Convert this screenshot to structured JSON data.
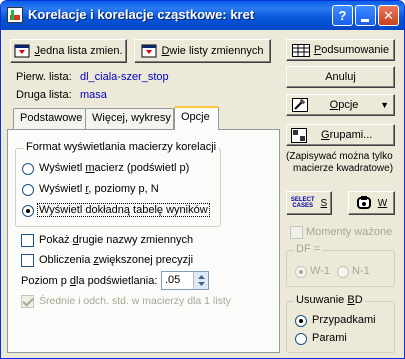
{
  "window": {
    "title": "Korelacje i korelacje cząstkowe: kret"
  },
  "buttons": {
    "jedna_lista": {
      "underline": "J",
      "rest": "edna lista zmien."
    },
    "dwie_listy": {
      "underline": "D",
      "rest": "wie listy zmiennych"
    },
    "podsumowanie": {
      "underline": "P",
      "rest": "odsumowanie"
    },
    "anuluj": "Anuluj",
    "opcje": {
      "underline": "O",
      "rest": "pcje"
    },
    "grupami": {
      "underline": "G",
      "rest": "rupami..."
    },
    "select_cases": {
      "line1": "SELECT",
      "line2": "CASES",
      "key": "S"
    },
    "weight": {
      "key": "W"
    }
  },
  "lists": {
    "first_label": "Pierw. lista:",
    "first_value": "dl_ciala-szer_stop",
    "second_label": "Druga lista:",
    "second_value": "masa"
  },
  "tabs": [
    {
      "label": "Podstawowe"
    },
    {
      "label": "Więcej, wykresy"
    },
    {
      "label": "Opcje"
    }
  ],
  "format_group": {
    "title": "Format wyświetlania macierzy korelacji",
    "options": [
      {
        "pre": "Wyświetl ",
        "u": "m",
        "post": "acierz (podświetl p)",
        "selected": false
      },
      {
        "pre": "Wyświetl ",
        "u": "r",
        "post": ", poziomy p, N",
        "selected": false
      },
      {
        "pre": "Wyświetl dokładną tabelę wyników",
        "u": "",
        "post": "",
        "selected": true
      }
    ]
  },
  "checkboxes": [
    {
      "pre": "Pokaż ",
      "u": "d",
      "post": "rugie nazwy zmiennych",
      "checked": false,
      "disabled": false
    },
    {
      "pre": "Obliczenia ",
      "u": "z",
      "post": "większonej precyzji",
      "checked": false,
      "disabled": false
    }
  ],
  "poziom": {
    "pre": "Poziom p ",
    "u": "d",
    "post": "la podświetlania:",
    "value": ".05"
  },
  "srednie": {
    "text": "Średnie i odch. std. w macierzy  dla 1 listy",
    "checked": true,
    "disabled": true
  },
  "note": {
    "line1": "(Zapisywać można tylko",
    "line2": "macierze kwadratowe)"
  },
  "momenty": {
    "label": "Momenty ważone",
    "checked": false,
    "disabled": true
  },
  "df_group": {
    "title": "DF =",
    "options": [
      {
        "label": "W-1",
        "selected": true
      },
      {
        "label": "N-1",
        "selected": false
      }
    ]
  },
  "usuwanie_group": {
    "title_pre": "Usuwanie ",
    "title_u": "B",
    "title_post": "D",
    "options": [
      {
        "label": "Przypadkami",
        "selected": true
      },
      {
        "label": "Parami",
        "selected": false
      }
    ]
  }
}
